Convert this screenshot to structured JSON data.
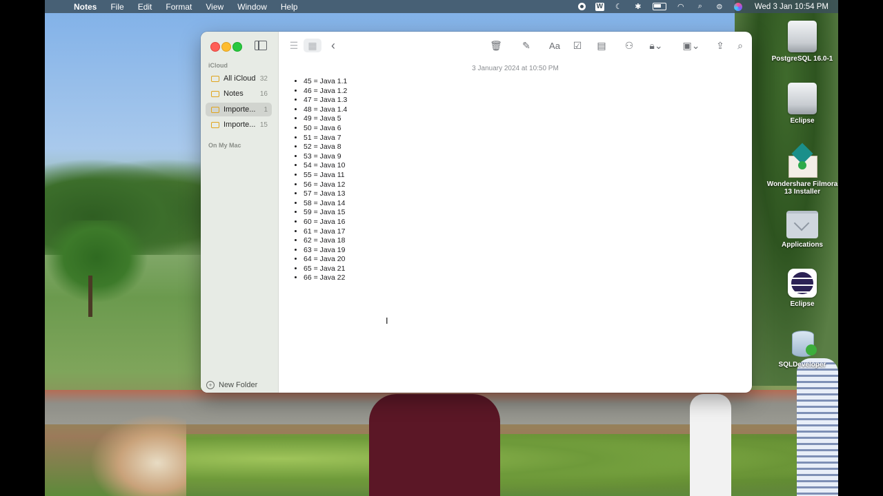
{
  "menubar": {
    "app_name": "Notes",
    "menus": [
      "File",
      "Edit",
      "Format",
      "View",
      "Window",
      "Help"
    ],
    "clock": "Wed 3 Jan  10:54 PM"
  },
  "desktop": {
    "icons": [
      {
        "label": "PostgreSQL 16.0-1",
        "icon": "disk-image-icon"
      },
      {
        "label": "Eclipse",
        "icon": "disk-image-icon"
      },
      {
        "label": "Wondershare Filmora 13 Installer",
        "icon": "installer-package-icon"
      },
      {
        "label": "Applications",
        "icon": "applications-folder-icon"
      },
      {
        "label": "Eclipse",
        "icon": "eclipse-app-icon"
      },
      {
        "label": "SQLDeveloper",
        "icon": "sqldeveloper-app-icon"
      }
    ]
  },
  "sidebar": {
    "section_icloud": "iCloud",
    "folders": [
      {
        "name": "All iCloud",
        "count": "32",
        "selected": false
      },
      {
        "name": "Notes",
        "count": "16",
        "selected": false
      },
      {
        "name": "Importe...",
        "count": "1",
        "selected": true
      },
      {
        "name": "Importe...",
        "count": "15",
        "selected": false
      }
    ],
    "section_mac": "On My Mac",
    "new_folder": "New Folder"
  },
  "toolbar": {
    "aa_label": "Aa"
  },
  "note": {
    "date": "3 January 2024 at 10:50 PM",
    "items": [
      "45 = Java 1.1",
      "46 = Java 1.2",
      "47 = Java 1.3",
      "48 = Java 1.4",
      "49 = Java 5",
      "50 = Java 6",
      "51 = Java 7",
      "52 = Java 8",
      "53 = Java 9",
      "54 = Java 10",
      "55 = Java 11",
      "56 = Java 12",
      "57 = Java 13",
      "58 = Java 14",
      "59 = Java 15",
      "60 = Java 16",
      "61 = Java 17",
      "62 = Java 18",
      "63 = Java 19",
      "64 = Java 20",
      "65 = Java 21",
      "66 = Java 22"
    ]
  },
  "colors": {
    "accent_folder": "#e0a41b",
    "close": "#ff5f57",
    "minimize": "#febc2e",
    "zoom": "#28c840"
  }
}
